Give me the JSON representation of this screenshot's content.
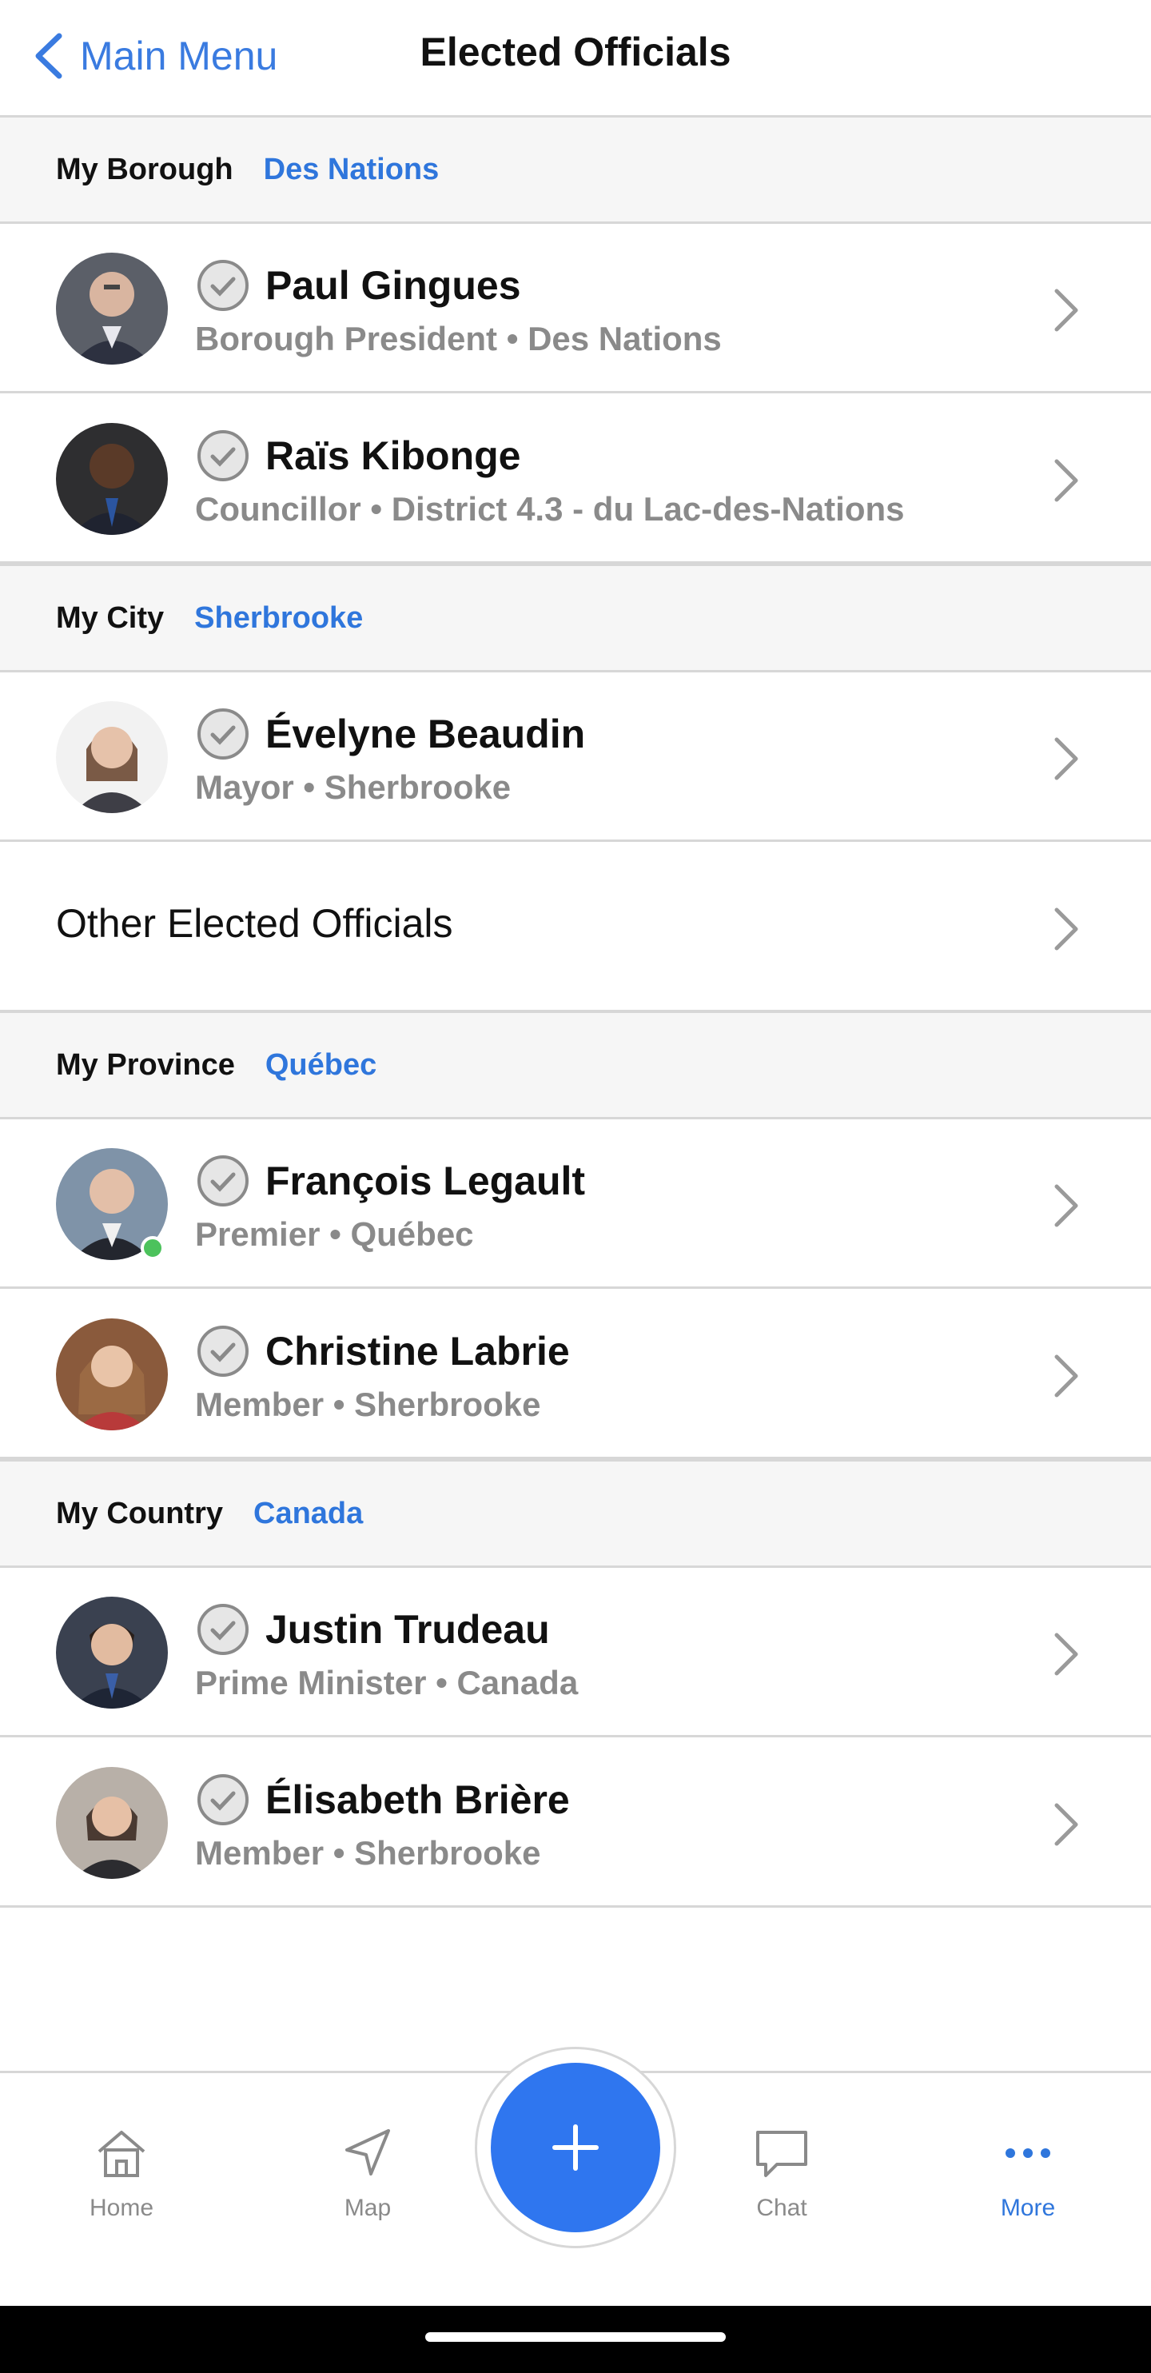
{
  "header": {
    "back_label": "Main Menu",
    "title": "Elected Officials"
  },
  "sections": {
    "borough": {
      "label": "My Borough",
      "value": "Des Nations"
    },
    "city": {
      "label": "My City",
      "value": "Sherbrooke"
    },
    "province": {
      "label": "My Province",
      "value": "Québec"
    },
    "country": {
      "label": "My Country",
      "value": "Canada"
    }
  },
  "officials": [
    {
      "name": "Paul Gingues",
      "subtitle": "Borough President • Des Nations",
      "online": false
    },
    {
      "name": "Raïs Kibonge",
      "subtitle": "Councillor • District 4.3 - du Lac-des-Nations",
      "online": false
    },
    {
      "name": "Évelyne Beaudin",
      "subtitle": "Mayor • Sherbrooke",
      "online": false
    },
    {
      "name": "François Legault",
      "subtitle": "Premier • Québec",
      "online": true
    },
    {
      "name": "Christine Labrie",
      "subtitle": "Member • Sherbrooke",
      "online": false
    },
    {
      "name": "Justin Trudeau",
      "subtitle": "Prime Minister • Canada",
      "online": false
    },
    {
      "name": "Élisabeth Brière",
      "subtitle": "Member • Sherbrooke",
      "online": false
    }
  ],
  "other_officials_label": "Other Elected Officials",
  "tabbar": {
    "home": "Home",
    "map": "Map",
    "chat": "Chat",
    "more": "More",
    "active": "More"
  },
  "colors": {
    "accent": "#2f76dc",
    "fab": "#2f76ef",
    "online": "#4cc25c"
  },
  "icons": {
    "back": "chevron-left-icon",
    "verified": "verified-badge-icon",
    "row_arrow": "chevron-right-icon",
    "home": "home-icon",
    "map": "navigation-arrow-icon",
    "add": "plus-icon",
    "chat": "chat-bubble-icon",
    "more": "more-dots-icon"
  }
}
